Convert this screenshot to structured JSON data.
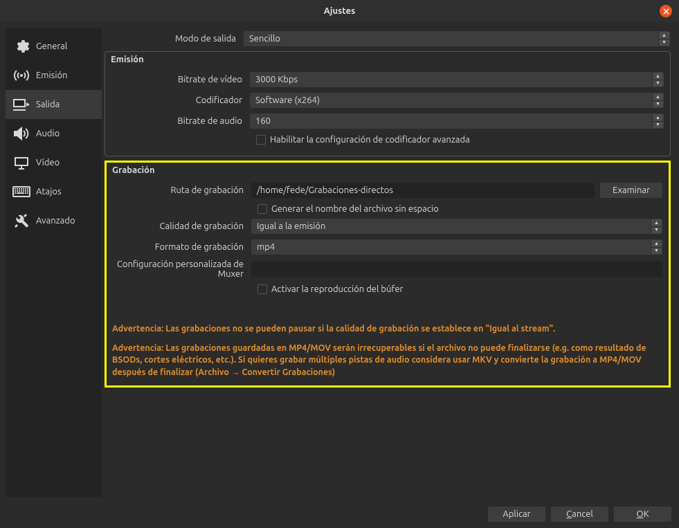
{
  "window": {
    "title": "Ajustes"
  },
  "sidebar": {
    "items": [
      {
        "label": "General"
      },
      {
        "label": "Emisión"
      },
      {
        "label": "Salida"
      },
      {
        "label": "Audio"
      },
      {
        "label": "Vídeo"
      },
      {
        "label": "Atajos"
      },
      {
        "label": "Avanzado"
      }
    ]
  },
  "output": {
    "mode_label": "Modo de salida",
    "mode_value": "Sencillo",
    "streaming": {
      "title": "Emisión",
      "video_bitrate_label": "Bitrate de vídeo",
      "video_bitrate_value": "3000 Kbps",
      "encoder_label": "Codificador",
      "encoder_value": "Software (x264)",
      "audio_bitrate_label": "Bitrate de audio",
      "audio_bitrate_value": "160",
      "advanced_checkbox": "Habilitar la configuración de codificador avanzada"
    },
    "recording": {
      "title": "Grabación",
      "path_label": "Ruta de grabación",
      "path_value": "/home/fede/Grabaciones-directos",
      "browse_label": "Examinar",
      "nospace_checkbox": "Generar el nombre del archivo sin espacio",
      "quality_label": "Calidad de grabación",
      "quality_value": "Igual a la emisión",
      "format_label": "Formato de grabación",
      "format_value": "mp4",
      "muxer_label": "Configuración personalizada de Muxer",
      "muxer_value": "",
      "replay_checkbox": "Activar la reproducción del búfer",
      "warning1": "Advertencia: Las grabaciones no se pueden pausar si la calidad de grabación se establece en \"Igual al stream\".",
      "warning2": "Advertencia: Las grabaciones guardadas en MP4/MOV serán irrecuperables si el archivo no puede finalizarse (e.g. como resultado de BSODs, cortes eléctricos, etc.). Si quieres grabar múltiples pistas de audio considera usar MKV y convierte la grabación a MP4/MOV después de finalizar (Archivo → Convertir Grabaciones)"
    }
  },
  "footer": {
    "apply": "Aplicar",
    "cancel": "Cancel",
    "ok": "OK"
  }
}
